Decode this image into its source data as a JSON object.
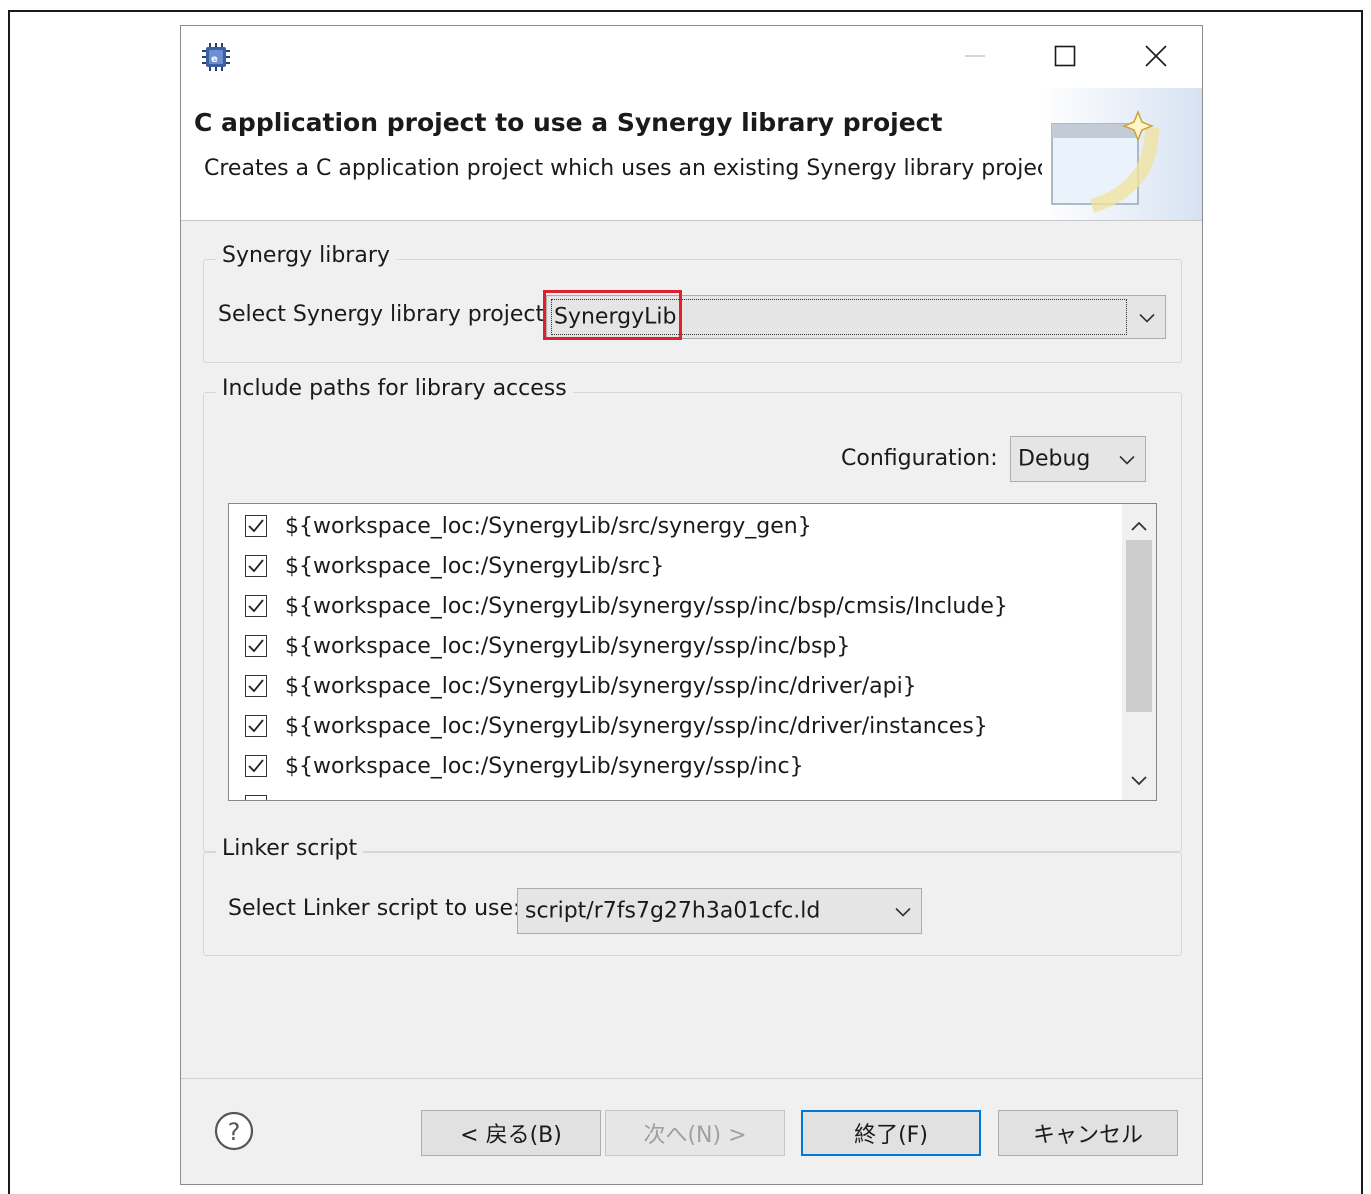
{
  "dialog": {
    "header": {
      "title": "C application project to use a Synergy library project",
      "description": "Creates a C application project which uses an existing Synergy library project"
    },
    "synergy_group": {
      "title": "Synergy library",
      "select_label": "Select Synergy library project:",
      "selected_value": "SynergyLib"
    },
    "include_group": {
      "title": "Include paths for library access",
      "config_label": "Configuration:",
      "config_value": "Debug",
      "paths": [
        "${workspace_loc:/SynergyLib/src/synergy_gen}",
        "${workspace_loc:/SynergyLib/src}",
        "${workspace_loc:/SynergyLib/synergy/ssp/inc/bsp/cmsis/Include}",
        "${workspace_loc:/SynergyLib/synergy/ssp/inc/bsp}",
        "${workspace_loc:/SynergyLib/synergy/ssp/inc/driver/api}",
        "${workspace_loc:/SynergyLib/synergy/ssp/inc/driver/instances}",
        "${workspace_loc:/SynergyLib/synergy/ssp/inc}"
      ]
    },
    "linker_group": {
      "title": "Linker script",
      "select_label": "Select Linker script to use:",
      "selected_value": "script/r7fs7g27h3a01cfc.ld"
    },
    "buttons": {
      "back": "< 戻る(B)",
      "next": "次へ(N) >",
      "finish": "終了(F)",
      "cancel": "キャンセル"
    }
  },
  "colors": {
    "highlight": "#e0202f",
    "default_button_border": "#0078d7"
  }
}
